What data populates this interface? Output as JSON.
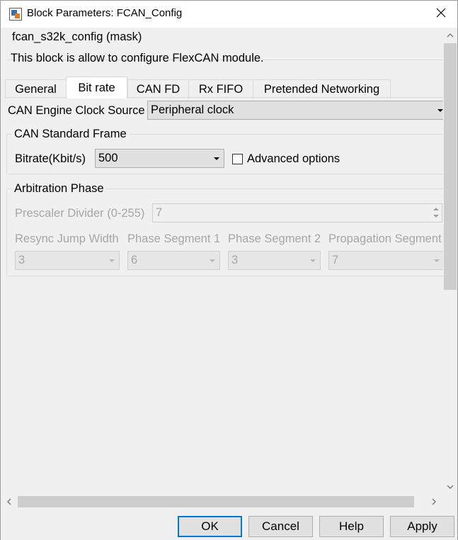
{
  "window": {
    "title": "Block Parameters: FCAN_Config",
    "icon": "simulink-block-icon",
    "close_icon": "close-icon"
  },
  "mask": {
    "title": "fcan_s32k_config (mask)",
    "description": "This block is allow to configure FlexCAN module."
  },
  "tabs": [
    {
      "label": "General"
    },
    {
      "label": "Bit rate",
      "active": true
    },
    {
      "label": "CAN FD"
    },
    {
      "label": "Rx FIFO"
    },
    {
      "label": "Pretended Networking"
    }
  ],
  "clock_source": {
    "label": "CAN Engine Clock Source",
    "value": "Peripheral clock"
  },
  "standard_frame": {
    "title": "CAN Standard Frame",
    "bitrate_label": "Bitrate(Kbit/s)",
    "bitrate_value": "500",
    "advanced_label": "Advanced options",
    "advanced_checked": false
  },
  "arbitration": {
    "title": "Arbitration Phase",
    "prescaler_label": "Prescaler Divider (0-255)",
    "prescaler_value": "7",
    "resync_label": "Resync Jump Width",
    "resync_value": "3",
    "phase1_label": "Phase Segment 1",
    "phase1_value": "6",
    "phase2_label": "Phase Segment 2",
    "phase2_value": "3",
    "prop_label": "Propagation Segment",
    "prop_value": "7"
  },
  "scroll": {
    "up_icon": "chevron-up-icon",
    "down_icon": "chevron-down-icon",
    "left_icon": "chevron-left-icon",
    "right_icon": "chevron-right-icon"
  },
  "buttons": {
    "ok": "OK",
    "cancel": "Cancel",
    "help": "Help",
    "apply": "Apply"
  },
  "colors": {
    "default_button_border": "#0078d7",
    "disabled_text": "#a6a6a6"
  }
}
